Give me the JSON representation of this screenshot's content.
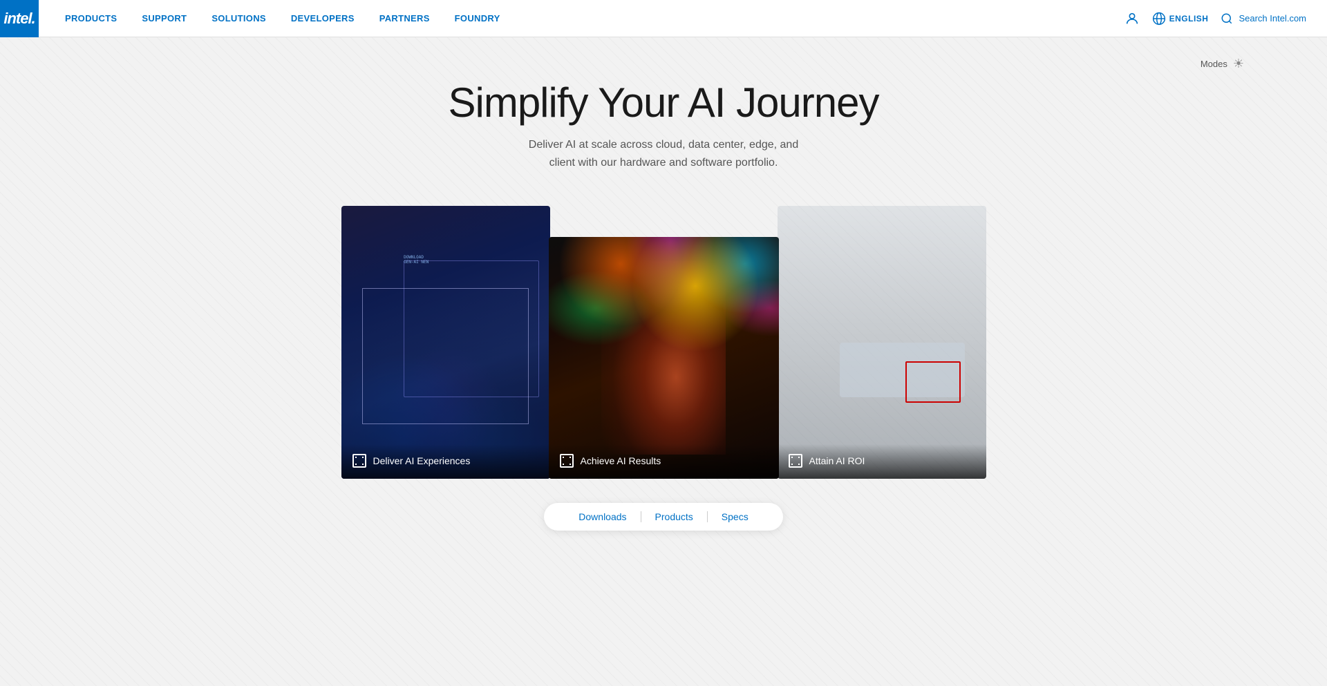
{
  "nav": {
    "logo_text": "intel.",
    "links": [
      {
        "label": "PRODUCTS",
        "id": "products"
      },
      {
        "label": "SUPPORT",
        "id": "support"
      },
      {
        "label": "SOLUTIONS",
        "id": "solutions"
      },
      {
        "label": "DEVELOPERS",
        "id": "developers"
      },
      {
        "label": "PARTNERS",
        "id": "partners"
      },
      {
        "label": "FOUNDRY",
        "id": "foundry"
      }
    ],
    "language": "ENGLISH",
    "search_placeholder": "Search Intel.com"
  },
  "modes": {
    "label": "Modes"
  },
  "hero": {
    "title": "Simplify Your AI Journey",
    "subtitle_line1": "Deliver AI at scale across cloud, data center, edge, and",
    "subtitle_line2": "client with our hardware and software portfolio."
  },
  "cards": [
    {
      "id": "deliver",
      "label": "Deliver AI Experiences"
    },
    {
      "id": "achieve",
      "label": "Achieve AI Results"
    },
    {
      "id": "attain",
      "label": "Attain AI ROI"
    }
  ],
  "bottom_nav": {
    "items": [
      {
        "label": "Downloads",
        "id": "downloads"
      },
      {
        "label": "Products",
        "id": "products"
      },
      {
        "label": "Specs",
        "id": "specs"
      }
    ]
  }
}
